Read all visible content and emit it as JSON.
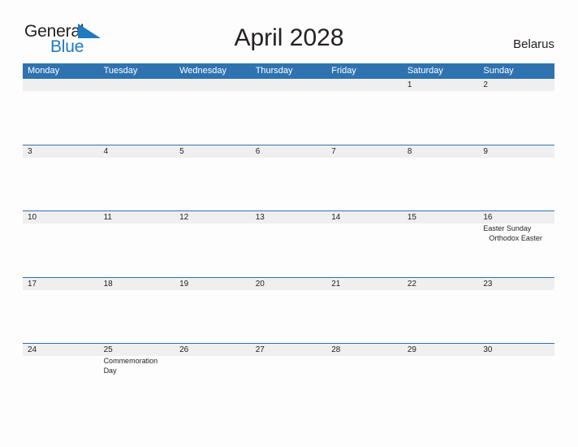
{
  "brand": {
    "name_top": "General",
    "name_bottom": "Blue",
    "flag_icon": "blue-triangle-flag-icon",
    "accent_color": "#1f7ac0"
  },
  "header": {
    "title": "April 2028",
    "country": "Belarus"
  },
  "theme": {
    "header_blue": "#2e73b0",
    "band_gray": "#efefef",
    "page_background": "#fdfdfd",
    "text_color": "#231f20"
  },
  "calendar": {
    "weekdays": [
      "Monday",
      "Tuesday",
      "Wednesday",
      "Thursday",
      "Friday",
      "Saturday",
      "Sunday"
    ],
    "weeks": [
      {
        "days": [
          {
            "date": "",
            "events": []
          },
          {
            "date": "",
            "events": []
          },
          {
            "date": "",
            "events": []
          },
          {
            "date": "",
            "events": []
          },
          {
            "date": "",
            "events": []
          },
          {
            "date": "1",
            "events": []
          },
          {
            "date": "2",
            "events": []
          }
        ]
      },
      {
        "days": [
          {
            "date": "3",
            "events": []
          },
          {
            "date": "4",
            "events": []
          },
          {
            "date": "5",
            "events": []
          },
          {
            "date": "6",
            "events": []
          },
          {
            "date": "7",
            "events": []
          },
          {
            "date": "8",
            "events": []
          },
          {
            "date": "9",
            "events": []
          }
        ]
      },
      {
        "days": [
          {
            "date": "10",
            "events": []
          },
          {
            "date": "11",
            "events": []
          },
          {
            "date": "12",
            "events": []
          },
          {
            "date": "13",
            "events": []
          },
          {
            "date": "14",
            "events": []
          },
          {
            "date": "15",
            "events": []
          },
          {
            "date": "16",
            "events": [
              "Easter Sunday",
              "Orthodox Easter"
            ]
          }
        ]
      },
      {
        "days": [
          {
            "date": "17",
            "events": []
          },
          {
            "date": "18",
            "events": []
          },
          {
            "date": "19",
            "events": []
          },
          {
            "date": "20",
            "events": []
          },
          {
            "date": "21",
            "events": []
          },
          {
            "date": "22",
            "events": []
          },
          {
            "date": "23",
            "events": []
          }
        ]
      },
      {
        "days": [
          {
            "date": "24",
            "events": []
          },
          {
            "date": "25",
            "events": [
              "Commemoration Day"
            ]
          },
          {
            "date": "26",
            "events": []
          },
          {
            "date": "27",
            "events": []
          },
          {
            "date": "28",
            "events": []
          },
          {
            "date": "29",
            "events": []
          },
          {
            "date": "30",
            "events": []
          }
        ]
      }
    ]
  }
}
